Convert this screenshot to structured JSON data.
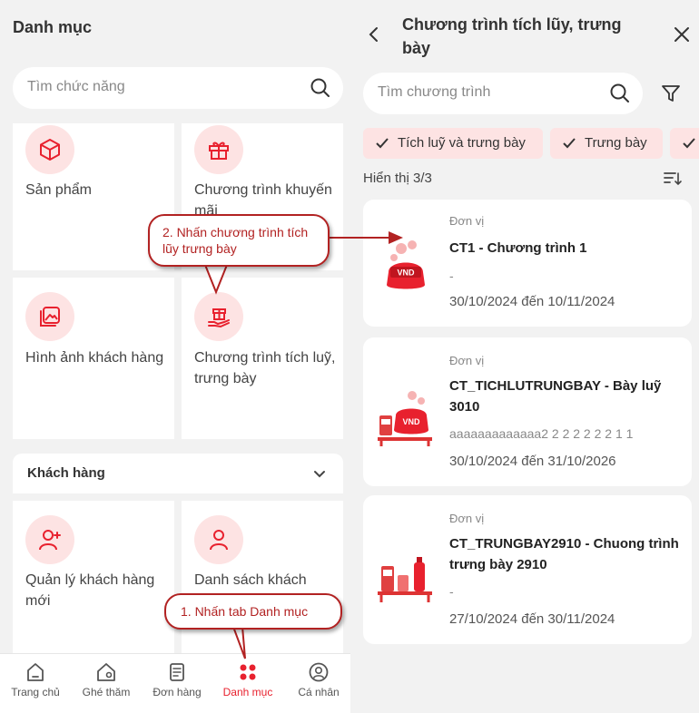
{
  "colors": {
    "accent": "#e8212e",
    "callout": "#b22222",
    "chip_bg": "#fde3e3"
  },
  "left": {
    "title": "Danh mục",
    "search_placeholder": "Tìm chức năng",
    "cards": [
      {
        "label": "Sản phẩm",
        "icon": "box-icon"
      },
      {
        "label": "Chương trình khuyến mãi",
        "icon": "gift-icon"
      },
      {
        "label": "Hình ảnh khách hàng",
        "icon": "image-gallery-icon"
      },
      {
        "label": "Chương trình tích luỹ, trưng bày",
        "icon": "gift-hand-icon"
      }
    ],
    "section": {
      "title": "Khách hàng"
    },
    "customer_cards": [
      {
        "label": "Quản lý khách hàng mới",
        "icon": "user-add-icon"
      },
      {
        "label": "Danh sách khách",
        "icon": "user-icon"
      }
    ],
    "nav": [
      {
        "label": "Trang chủ",
        "icon": "home-icon"
      },
      {
        "label": "Ghé thăm",
        "icon": "visit-location-icon"
      },
      {
        "label": "Đơn hàng",
        "icon": "order-document-icon"
      },
      {
        "label": "Danh mục",
        "icon": "grid-dots-icon",
        "active": true
      },
      {
        "label": "Cá nhân",
        "icon": "profile-icon"
      }
    ]
  },
  "right": {
    "title": "Chương trình tích lũy, trưng bày",
    "search_placeholder": "Tìm chương trình",
    "chips": [
      "Tích luỹ và trưng bày",
      "Trưng bày",
      ""
    ],
    "showing": "Hiển thị 3/3",
    "programs": [
      {
        "unit": "Đơn vị",
        "name": "CT1 - Chương trình 1",
        "desc": "-",
        "date": "30/10/2024 đến 10/11/2024"
      },
      {
        "unit": "Đơn vị",
        "name": "CT_TICHLUTRUNGBAY - Bày luỹ 3010",
        "desc": "aaaaaaaaaaaaa2 2 2 2 2 2 2 1 1",
        "date": "30/10/2024 đến 31/10/2026"
      },
      {
        "unit": "Đơn vị",
        "name": "CT_TRUNGBAY2910 - Chuong trình trưng bày 2910",
        "desc": "-",
        "date": "27/10/2024 đến 30/11/2024"
      }
    ]
  },
  "callouts": {
    "step1": "1. Nhấn tab Danh mục",
    "step2": "2. Nhấn chương trình tích lũy trưng bày"
  },
  "badge_text": "VND"
}
